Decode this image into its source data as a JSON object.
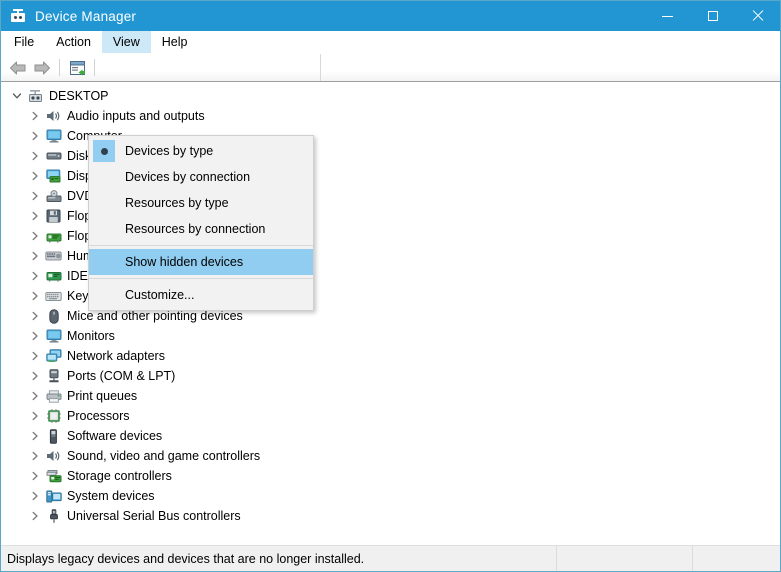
{
  "window": {
    "title": "Device Manager",
    "title_icon": "device-manager-icon",
    "controls": {
      "minimize": "minimize-icon",
      "maximize": "maximize-icon",
      "close": "close-icon"
    }
  },
  "menubar": {
    "items": [
      {
        "label": "File",
        "active": false
      },
      {
        "label": "Action",
        "active": false
      },
      {
        "label": "View",
        "active": true
      },
      {
        "label": "Help",
        "active": false
      }
    ]
  },
  "toolbar": {
    "buttons": [
      {
        "name": "back-icon",
        "title": "Back"
      },
      {
        "name": "forward-icon",
        "title": "Forward"
      },
      {
        "name": "properties-icon",
        "title": "Properties"
      }
    ]
  },
  "view_menu": {
    "items": [
      {
        "label": "Devices by type",
        "radio": true,
        "selected_radio": true,
        "highlighted": false
      },
      {
        "label": "Devices by connection",
        "radio": false,
        "selected_radio": false,
        "highlighted": false
      },
      {
        "label": "Resources by type",
        "radio": false,
        "selected_radio": false,
        "highlighted": false
      },
      {
        "label": "Resources by connection",
        "radio": false,
        "selected_radio": false,
        "highlighted": false
      },
      {
        "separator": true
      },
      {
        "label": "Show hidden devices",
        "radio": false,
        "selected_radio": false,
        "highlighted": true
      },
      {
        "separator": true
      },
      {
        "label": "Customize...",
        "radio": false,
        "selected_radio": false,
        "highlighted": false
      }
    ]
  },
  "tree": {
    "root": {
      "label": "DESKTOP",
      "icon": "computer-icon",
      "expanded": true
    },
    "items": [
      {
        "label": "Audio inputs and outputs",
        "icon": "speaker-icon"
      },
      {
        "label": "Computer",
        "icon": "monitor-icon"
      },
      {
        "label": "Disk drives",
        "icon": "disk-icon"
      },
      {
        "label": "Display adapters",
        "icon": "display-adapter-icon"
      },
      {
        "label": "DVD/CD-ROM drives",
        "icon": "dvd-icon"
      },
      {
        "label": "Floppy disk drives",
        "icon": "floppy-disk-icon"
      },
      {
        "label": "Floppy drive controllers",
        "icon": "floppy-controller-icon"
      },
      {
        "label": "Human Interface Devices",
        "icon": "hid-icon"
      },
      {
        "label": "IDE ATA/ATAPI controllers",
        "icon": "ide-controller-icon"
      },
      {
        "label": "Keyboards",
        "icon": "keyboard-icon"
      },
      {
        "label": "Mice and other pointing devices",
        "icon": "mouse-icon"
      },
      {
        "label": "Monitors",
        "icon": "monitor-icon"
      },
      {
        "label": "Network adapters",
        "icon": "network-adapter-icon"
      },
      {
        "label": "Ports (COM & LPT)",
        "icon": "port-icon"
      },
      {
        "label": "Print queues",
        "icon": "printer-icon"
      },
      {
        "label": "Processors",
        "icon": "processor-icon"
      },
      {
        "label": "Software devices",
        "icon": "software-device-icon"
      },
      {
        "label": "Sound, video and game controllers",
        "icon": "speaker-icon"
      },
      {
        "label": "Storage controllers",
        "icon": "storage-controller-icon"
      },
      {
        "label": "System devices",
        "icon": "system-device-icon"
      },
      {
        "label": "Universal Serial Bus controllers",
        "icon": "usb-icon"
      }
    ]
  },
  "statusbar": {
    "message": "Displays legacy devices and devices that are no longer installed.",
    "panel2": "",
    "panel3": ""
  },
  "colors": {
    "titlebar": "#2196d3",
    "menu_highlight": "#90cdf0",
    "menu_active_tab": "#cde8f6",
    "window_border": "#5aa7c8"
  }
}
